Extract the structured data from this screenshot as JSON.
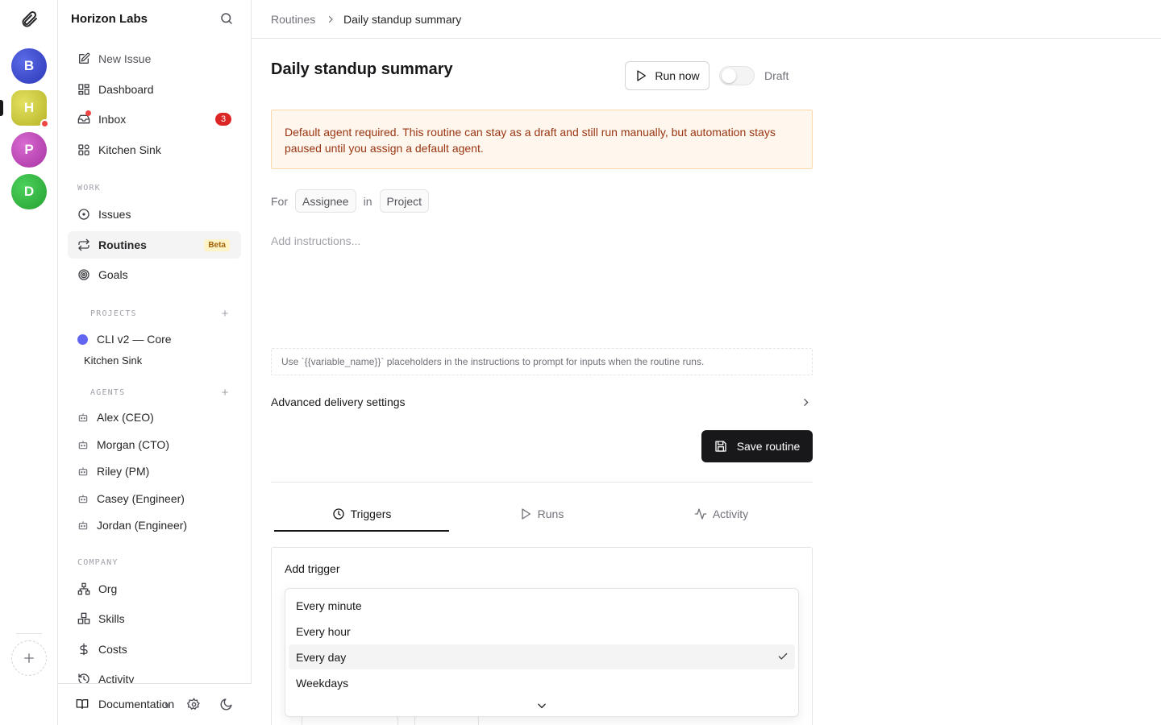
{
  "rail": {
    "workspaces": [
      {
        "initial": "B",
        "color": "#3a47cc"
      },
      {
        "initial": "H",
        "color": "#cfcc3e"
      },
      {
        "initial": "P",
        "color": "#c24cba"
      },
      {
        "initial": "D",
        "color": "#34b845"
      }
    ]
  },
  "sidebar": {
    "org_name": "Horizon Labs",
    "top_items": [
      {
        "label": "New Issue",
        "icon": "pencil-square-icon"
      },
      {
        "label": "Dashboard",
        "icon": "dashboard-icon"
      },
      {
        "label": "Inbox",
        "icon": "inbox-icon",
        "badge": "3"
      },
      {
        "label": "Kitchen Sink",
        "icon": "grid-icon"
      }
    ],
    "work_label": "WORK",
    "work_items": [
      {
        "label": "Issues",
        "icon": "circle-dot-icon"
      },
      {
        "label": "Routines",
        "icon": "repeat-icon",
        "badge": "Beta"
      },
      {
        "label": "Goals",
        "icon": "target-icon"
      }
    ],
    "projects_label": "PROJECTS",
    "projects": [
      {
        "label": "CLI v2 — Core",
        "color": "#6366f1"
      }
    ],
    "sub_project": "Kitchen Sink",
    "agents_label": "AGENTS",
    "agents": [
      "Alex (CEO)",
      "Morgan (CTO)",
      "Riley (PM)",
      "Casey (Engineer)",
      "Jordan (Engineer)"
    ],
    "company_label": "COMPANY",
    "company_items": [
      {
        "label": "Org",
        "icon": "org-chart-icon"
      },
      {
        "label": "Skills",
        "icon": "boxes-icon"
      },
      {
        "label": "Costs",
        "icon": "dollar-icon"
      },
      {
        "label": "Activity",
        "icon": "history-icon"
      }
    ],
    "footer": {
      "doc_label": "Documentation",
      "version": "v"
    }
  },
  "breadcrumb": {
    "parent": "Routines",
    "current": "Daily standup summary"
  },
  "routine": {
    "title": "Daily standup summary",
    "run_label": "Run now",
    "status_label": "Draft",
    "warning": "Default agent required. This routine can stay as a draft and still run manually, but automation stays paused until you assign a default agent.",
    "for_label": "For",
    "assignee_chip": "Assignee",
    "in_label": "in",
    "project_chip": "Project",
    "instructions_placeholder": "Add instructions...",
    "hint": "Use `{{variable_name}}` placeholders in the instructions to prompt for inputs when the routine runs.",
    "advanced_label": "Advanced delivery settings",
    "save_label": "Save routine"
  },
  "tabs": [
    {
      "label": "Triggers",
      "icon": "clock-icon",
      "active": true
    },
    {
      "label": "Runs",
      "icon": "play-icon",
      "active": false
    },
    {
      "label": "Activity",
      "icon": "pulse-icon",
      "active": false
    }
  ],
  "trigger_panel": {
    "title": "Add trigger",
    "options": [
      "Every minute",
      "Every hour",
      "Every day",
      "Weekdays"
    ],
    "selected": "Every day"
  }
}
